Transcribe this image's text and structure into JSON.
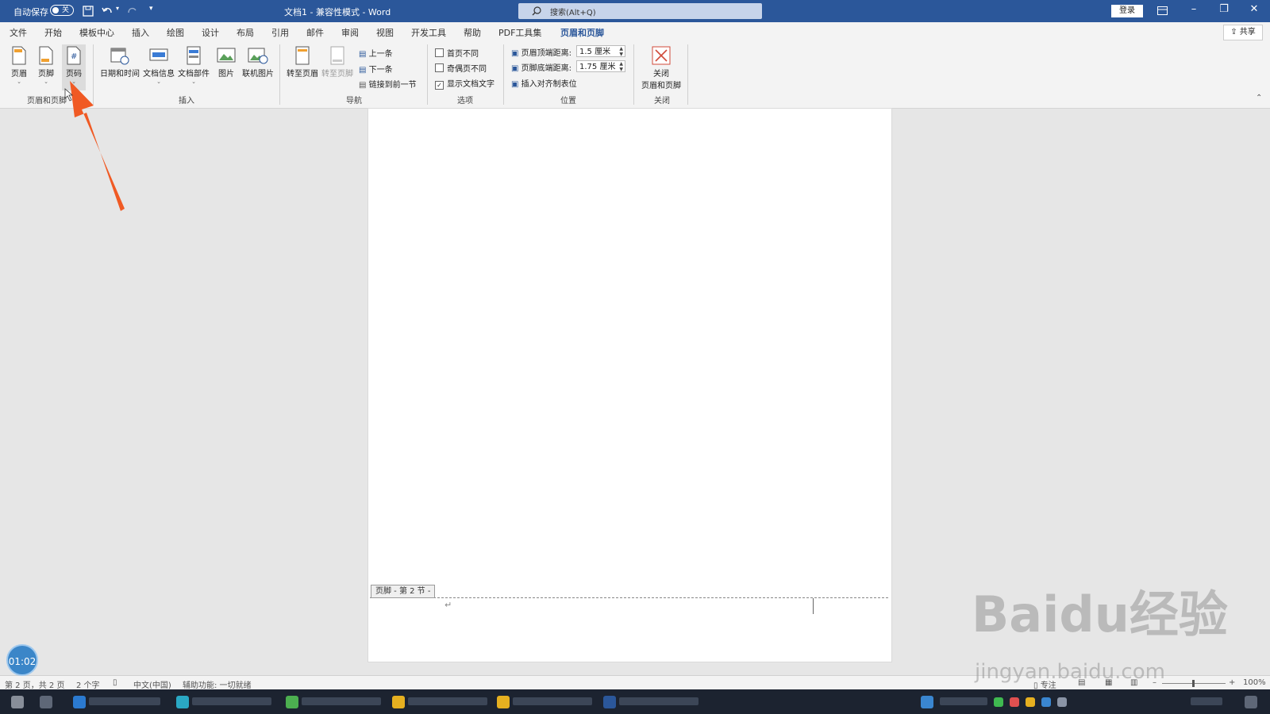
{
  "titlebar": {
    "autosave_label": "自动保存",
    "autosave_state": "关",
    "doc_title": "文档1 - 兼容性模式 - Word",
    "search_placeholder": "搜索(Alt+Q)",
    "login_label": "登录"
  },
  "menu": {
    "tabs": [
      "文件",
      "开始",
      "模板中心",
      "插入",
      "绘图",
      "设计",
      "布局",
      "引用",
      "邮件",
      "审阅",
      "视图",
      "开发工具",
      "帮助",
      "PDF工具集",
      "页眉和页脚"
    ],
    "active_tab": "页眉和页脚",
    "share_label": "共享"
  },
  "ribbon": {
    "group_headerfooter": {
      "label": "页眉和页脚",
      "buttons": [
        "页眉",
        "页脚",
        "页码"
      ]
    },
    "group_insert": {
      "label": "插入",
      "buttons": [
        "日期和时间",
        "文档信息",
        "文档部件",
        "图片",
        "联机图片"
      ]
    },
    "group_nav": {
      "label": "导航",
      "goto_header": "转至页眉",
      "goto_footer": "转至页脚",
      "prev": "上一条",
      "next": "下一条",
      "link_prev": "链接到前一节"
    },
    "group_options": {
      "label": "选项",
      "first_page": "首页不同",
      "odd_even": "奇偶页不同",
      "show_text": "显示文档文字",
      "show_text_checked": true
    },
    "group_position": {
      "label": "位置",
      "header_top_label": "页眉顶端距离:",
      "header_top_value": "1.5 厘米",
      "footer_bottom_label": "页脚底端距离:",
      "footer_bottom_value": "1.75 厘米",
      "insert_tab": "插入对齐制表位"
    },
    "group_close": {
      "label": "关闭",
      "close_line1": "关闭",
      "close_line2": "页眉和页脚"
    }
  },
  "document": {
    "footer_tag": "页脚 - 第 2 节 -"
  },
  "statusbar": {
    "page": "第 2 页，共 2 页",
    "words": "2 个字",
    "language": "中文(中国)",
    "accessibility": "辅助功能: 一切就绪",
    "focus": "专注",
    "zoom": "100%"
  },
  "overlay": {
    "timer": "01:02",
    "watermark": "Baidu经验",
    "watermark_url": "jingyan.baidu.com"
  },
  "colors": {
    "brand": "#2b579a",
    "arrow": "#f05a24"
  }
}
